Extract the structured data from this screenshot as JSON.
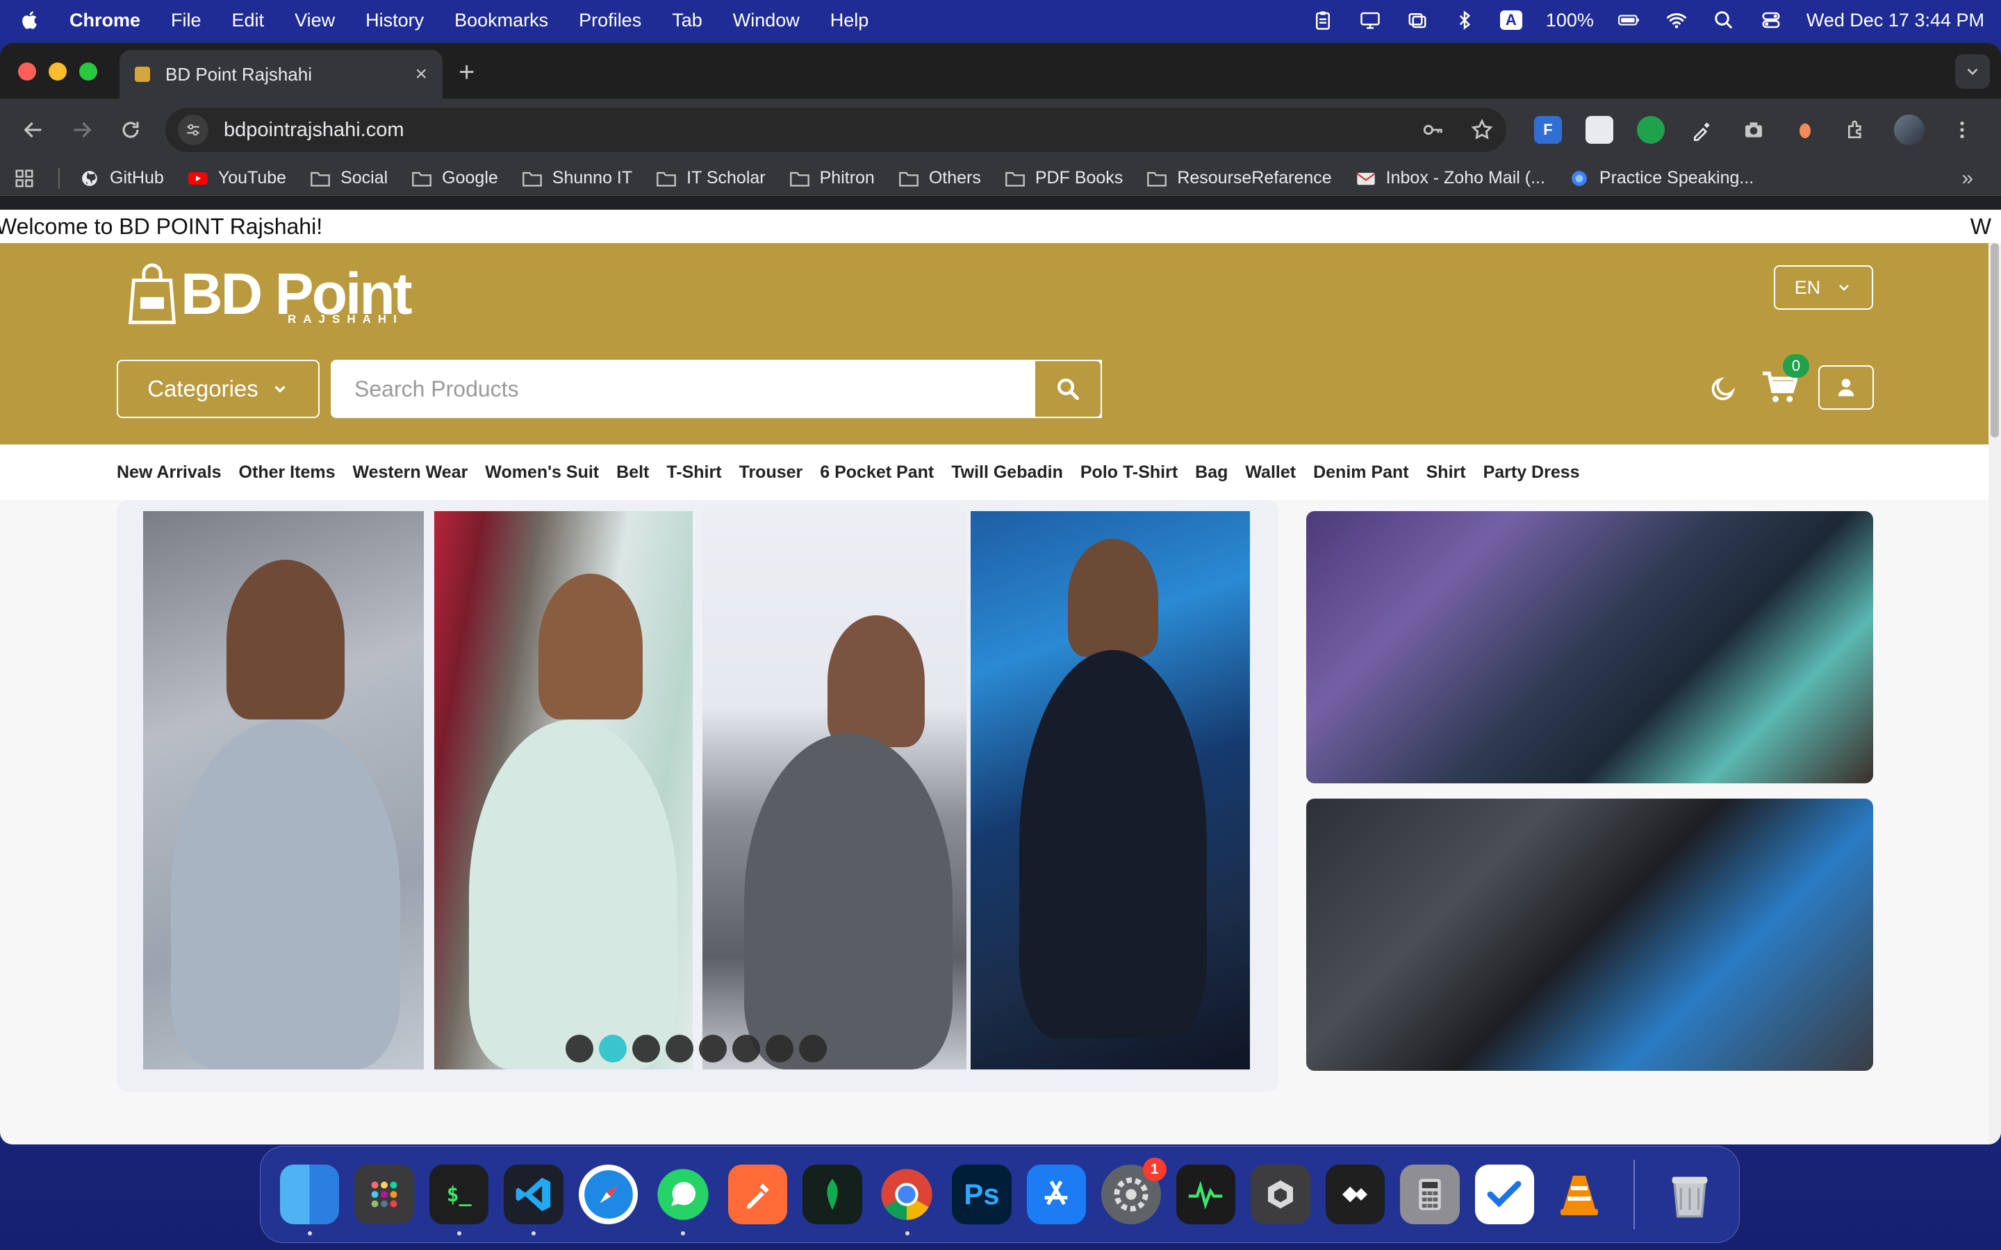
{
  "menubar": {
    "app_name": "Chrome",
    "items": [
      "File",
      "Edit",
      "View",
      "History",
      "Bookmarks",
      "Profiles",
      "Tab",
      "Window",
      "Help"
    ],
    "input_indicator": "A",
    "battery": "100%",
    "datetime": "Wed Dec 17  3:44 PM"
  },
  "browser": {
    "tab_title": "BD Point Rajshahi",
    "tab_close": "×",
    "new_tab": "+",
    "url": "bdpointrajshahi.com",
    "bookmarks": [
      {
        "label": "GitHub",
        "icon": "github-icon"
      },
      {
        "label": "YouTube",
        "icon": "youtube-icon"
      },
      {
        "label": "Social",
        "icon": "folder-icon"
      },
      {
        "label": "Google",
        "icon": "folder-icon"
      },
      {
        "label": "Shunno IT",
        "icon": "folder-icon"
      },
      {
        "label": "IT Scholar",
        "icon": "folder-icon"
      },
      {
        "label": "Phitron",
        "icon": "folder-icon"
      },
      {
        "label": "Others",
        "icon": "folder-icon"
      },
      {
        "label": "PDF Books",
        "icon": "folder-icon"
      },
      {
        "label": "ResourseRefarence",
        "icon": "folder-icon"
      },
      {
        "label": "Inbox - Zoho Mail (...",
        "icon": "zoho-mail-icon"
      },
      {
        "label": "Practice Speaking...",
        "icon": "globe-icon"
      }
    ],
    "bookmarks_overflow": "»"
  },
  "site": {
    "ticker": "Welcome to BD POINT Rajshahi!",
    "ticker_tail": "W",
    "logo_text": "BD Point",
    "logo_sub": "RAJSHAHI",
    "language": "EN",
    "categories_label": "Categories",
    "search_placeholder": "Search Products",
    "cart_count": "0",
    "nav": [
      "New Arrivals",
      "Other Items",
      "Western Wear",
      "Women's Suit",
      "Belt",
      "T-Shirt",
      "Trouser",
      "6 Pocket Pant",
      "Twill Gebadin",
      "Polo T-Shirt",
      "Bag",
      "Wallet",
      "Denim Pant",
      "Shirt",
      "Party Dress"
    ],
    "slider": {
      "slides": 8,
      "active_index": 1
    }
  },
  "colors": {
    "brand_gold": "#b99a3e",
    "slider_active": "#2cc0c9",
    "cart_badge": "#1fa24b"
  },
  "dock": {
    "apps": [
      "Finder",
      "Launchpad",
      "Terminal",
      "Visual Studio Code",
      "Safari",
      "WhatsApp",
      "Postman",
      "MongoDB Compass",
      "Google Chrome",
      "Photoshop",
      "App Store",
      "System Settings",
      "Activity Monitor",
      "Virtual Machine",
      "AnyDesk",
      "Calculator",
      "Tasks",
      "VLC",
      "Trash"
    ],
    "settings_badge": "1"
  }
}
